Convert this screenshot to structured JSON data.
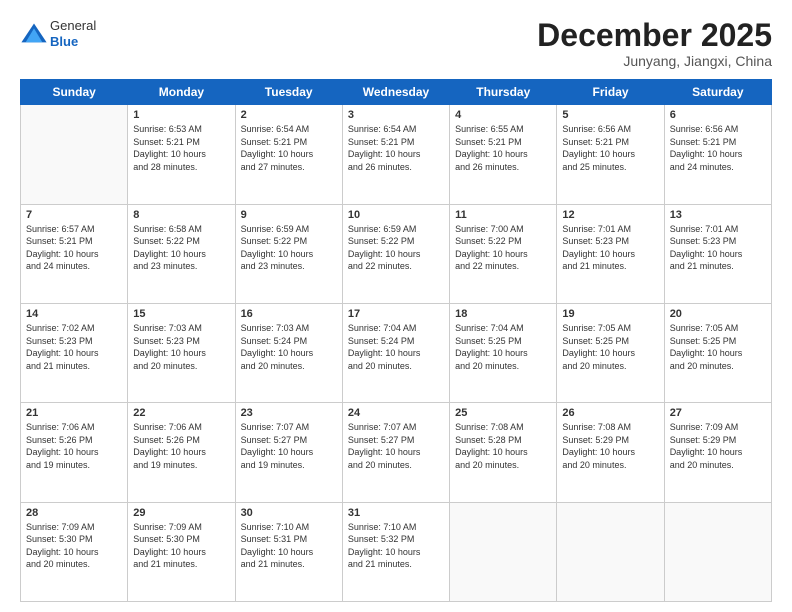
{
  "logo": {
    "general": "General",
    "blue": "Blue"
  },
  "title": "December 2025",
  "location": "Junyang, Jiangxi, China",
  "days_of_week": [
    "Sunday",
    "Monday",
    "Tuesday",
    "Wednesday",
    "Thursday",
    "Friday",
    "Saturday"
  ],
  "weeks": [
    [
      {
        "day": "",
        "content": ""
      },
      {
        "day": "1",
        "content": "Sunrise: 6:53 AM\nSunset: 5:21 PM\nDaylight: 10 hours\nand 28 minutes."
      },
      {
        "day": "2",
        "content": "Sunrise: 6:54 AM\nSunset: 5:21 PM\nDaylight: 10 hours\nand 27 minutes."
      },
      {
        "day": "3",
        "content": "Sunrise: 6:54 AM\nSunset: 5:21 PM\nDaylight: 10 hours\nand 26 minutes."
      },
      {
        "day": "4",
        "content": "Sunrise: 6:55 AM\nSunset: 5:21 PM\nDaylight: 10 hours\nand 26 minutes."
      },
      {
        "day": "5",
        "content": "Sunrise: 6:56 AM\nSunset: 5:21 PM\nDaylight: 10 hours\nand 25 minutes."
      },
      {
        "day": "6",
        "content": "Sunrise: 6:56 AM\nSunset: 5:21 PM\nDaylight: 10 hours\nand 24 minutes."
      }
    ],
    [
      {
        "day": "7",
        "content": "Sunrise: 6:57 AM\nSunset: 5:21 PM\nDaylight: 10 hours\nand 24 minutes."
      },
      {
        "day": "8",
        "content": "Sunrise: 6:58 AM\nSunset: 5:22 PM\nDaylight: 10 hours\nand 23 minutes."
      },
      {
        "day": "9",
        "content": "Sunrise: 6:59 AM\nSunset: 5:22 PM\nDaylight: 10 hours\nand 23 minutes."
      },
      {
        "day": "10",
        "content": "Sunrise: 6:59 AM\nSunset: 5:22 PM\nDaylight: 10 hours\nand 22 minutes."
      },
      {
        "day": "11",
        "content": "Sunrise: 7:00 AM\nSunset: 5:22 PM\nDaylight: 10 hours\nand 22 minutes."
      },
      {
        "day": "12",
        "content": "Sunrise: 7:01 AM\nSunset: 5:23 PM\nDaylight: 10 hours\nand 21 minutes."
      },
      {
        "day": "13",
        "content": "Sunrise: 7:01 AM\nSunset: 5:23 PM\nDaylight: 10 hours\nand 21 minutes."
      }
    ],
    [
      {
        "day": "14",
        "content": "Sunrise: 7:02 AM\nSunset: 5:23 PM\nDaylight: 10 hours\nand 21 minutes."
      },
      {
        "day": "15",
        "content": "Sunrise: 7:03 AM\nSunset: 5:23 PM\nDaylight: 10 hours\nand 20 minutes."
      },
      {
        "day": "16",
        "content": "Sunrise: 7:03 AM\nSunset: 5:24 PM\nDaylight: 10 hours\nand 20 minutes."
      },
      {
        "day": "17",
        "content": "Sunrise: 7:04 AM\nSunset: 5:24 PM\nDaylight: 10 hours\nand 20 minutes."
      },
      {
        "day": "18",
        "content": "Sunrise: 7:04 AM\nSunset: 5:25 PM\nDaylight: 10 hours\nand 20 minutes."
      },
      {
        "day": "19",
        "content": "Sunrise: 7:05 AM\nSunset: 5:25 PM\nDaylight: 10 hours\nand 20 minutes."
      },
      {
        "day": "20",
        "content": "Sunrise: 7:05 AM\nSunset: 5:25 PM\nDaylight: 10 hours\nand 20 minutes."
      }
    ],
    [
      {
        "day": "21",
        "content": "Sunrise: 7:06 AM\nSunset: 5:26 PM\nDaylight: 10 hours\nand 19 minutes."
      },
      {
        "day": "22",
        "content": "Sunrise: 7:06 AM\nSunset: 5:26 PM\nDaylight: 10 hours\nand 19 minutes."
      },
      {
        "day": "23",
        "content": "Sunrise: 7:07 AM\nSunset: 5:27 PM\nDaylight: 10 hours\nand 19 minutes."
      },
      {
        "day": "24",
        "content": "Sunrise: 7:07 AM\nSunset: 5:27 PM\nDaylight: 10 hours\nand 20 minutes."
      },
      {
        "day": "25",
        "content": "Sunrise: 7:08 AM\nSunset: 5:28 PM\nDaylight: 10 hours\nand 20 minutes."
      },
      {
        "day": "26",
        "content": "Sunrise: 7:08 AM\nSunset: 5:29 PM\nDaylight: 10 hours\nand 20 minutes."
      },
      {
        "day": "27",
        "content": "Sunrise: 7:09 AM\nSunset: 5:29 PM\nDaylight: 10 hours\nand 20 minutes."
      }
    ],
    [
      {
        "day": "28",
        "content": "Sunrise: 7:09 AM\nSunset: 5:30 PM\nDaylight: 10 hours\nand 20 minutes."
      },
      {
        "day": "29",
        "content": "Sunrise: 7:09 AM\nSunset: 5:30 PM\nDaylight: 10 hours\nand 21 minutes."
      },
      {
        "day": "30",
        "content": "Sunrise: 7:10 AM\nSunset: 5:31 PM\nDaylight: 10 hours\nand 21 minutes."
      },
      {
        "day": "31",
        "content": "Sunrise: 7:10 AM\nSunset: 5:32 PM\nDaylight: 10 hours\nand 21 minutes."
      },
      {
        "day": "",
        "content": ""
      },
      {
        "day": "",
        "content": ""
      },
      {
        "day": "",
        "content": ""
      }
    ]
  ]
}
